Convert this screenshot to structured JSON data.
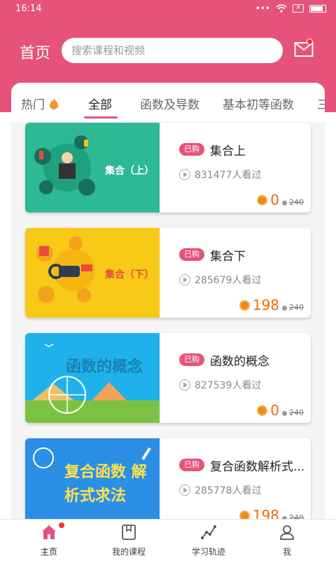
{
  "status_bar": {
    "time": "16:14",
    "icons": [
      "dots-icon",
      "wifi-icon",
      "close-box-icon",
      "battery-icon"
    ]
  },
  "header": {
    "title": "首页",
    "search_placeholder": "搜索课程和视频",
    "accent_color": "#e5537a",
    "mail_icon": "mail-icon"
  },
  "tabs": [
    {
      "label": "热门",
      "icon": "flame-icon",
      "active": false
    },
    {
      "label": "全部",
      "active": true
    },
    {
      "label": "函数及导数",
      "active": false
    },
    {
      "label": "基本初等函数",
      "active": false
    },
    {
      "label": "三",
      "active": false
    }
  ],
  "courses": [
    {
      "title": "集合上",
      "badge": "已购",
      "views": "831477人看过",
      "price": "0",
      "original_price": "240",
      "thumb_text": "集合（上）",
      "thumb_color": "#2db896"
    },
    {
      "title": "集合下",
      "badge": "已购",
      "views": "285679人看过",
      "price": "198",
      "original_price": "240",
      "thumb_text": "集合（下）",
      "thumb_color": "#f9c917"
    },
    {
      "title": "函数的概念",
      "badge": "已购",
      "views": "827539人看过",
      "price": "0",
      "original_price": "240",
      "thumb_text": "函数的概念",
      "thumb_color": "#1fb2ea"
    },
    {
      "title": "复合函数解析式...",
      "badge": "已购",
      "views": "285778人看过",
      "price": "198",
      "original_price": "240",
      "thumb_text": "复合函数 解析式求法",
      "thumb_color": "#2b8fe6"
    }
  ],
  "bottom_nav": [
    {
      "label": "主页",
      "icon": "home-icon",
      "active": true
    },
    {
      "label": "我的课程",
      "icon": "book-icon",
      "active": false
    },
    {
      "label": "学习轨迹",
      "icon": "trend-icon",
      "active": false
    },
    {
      "label": "我",
      "icon": "profile-icon",
      "active": false
    }
  ]
}
